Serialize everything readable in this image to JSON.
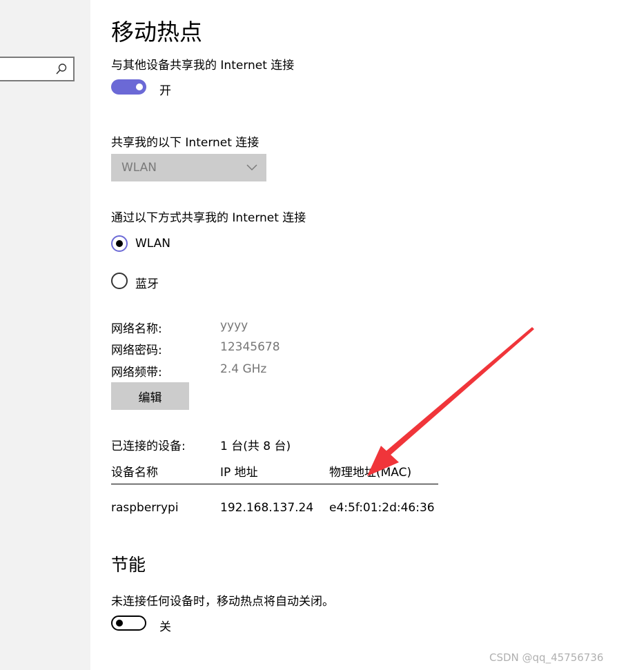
{
  "page": {
    "title": "移动热点",
    "share_label": "与其他设备共享我的 Internet 连接",
    "share_toggle": {
      "state_text": "开",
      "on": true
    },
    "share_from_label": "共享我的以下 Internet 连接",
    "share_from_value": "WLAN",
    "share_over_label": "通过以下方式共享我的 Internet 连接",
    "share_over_options": [
      {
        "label": "WLAN",
        "selected": true
      },
      {
        "label": "蓝牙",
        "selected": false
      }
    ],
    "network": {
      "name_label": "网络名称:",
      "name_value": "yyyy",
      "password_label": "网络密码:",
      "password_value": "12345678",
      "band_label": "网络频带:",
      "band_value": "2.4 GHz",
      "edit_button": "编辑"
    },
    "devices": {
      "connected_label": "已连接的设备:",
      "connected_value": "1 台(共 8 台)",
      "headers": [
        "设备名称",
        "IP 地址",
        "物理地址(MAC)"
      ],
      "rows": [
        {
          "name": "raspberrypi",
          "ip": "192.168.137.24",
          "mac": "e4:5f:01:2d:46:36"
        }
      ]
    },
    "power_saving": {
      "title": "节能",
      "description": "未连接任何设备时，移动热点将自动关闭。",
      "toggle": {
        "state_text": "关",
        "on": false
      }
    }
  },
  "watermark": "CSDN @qq_45756736",
  "colors": {
    "accent": "#6b69d6",
    "arrow": "#f0353a",
    "disabled_bg": "#cccccc"
  },
  "icons": {
    "search": "search-icon",
    "dropdown": "chevron-down-icon",
    "annotation": "red-arrow-icon"
  }
}
